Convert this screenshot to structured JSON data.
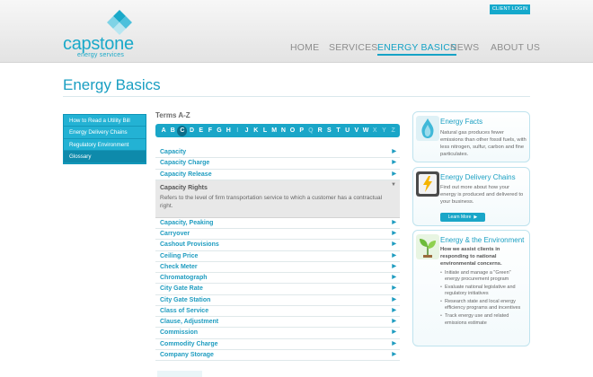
{
  "header": {
    "brand_name": "capstone",
    "brand_sub": "energy services",
    "client_login": "CLIENT LOGIN",
    "nav": [
      {
        "label": "HOME",
        "active": false
      },
      {
        "label": "SERVICES",
        "active": false
      },
      {
        "label": "ENERGY BASICS",
        "active": true
      },
      {
        "label": "NEWS",
        "active": false
      },
      {
        "label": "ABOUT US",
        "active": false
      }
    ]
  },
  "page": {
    "title": "Energy Basics"
  },
  "sidebar": {
    "items": [
      {
        "label": "How to Read a Utility Bill",
        "selected": false
      },
      {
        "label": "Energy Delivery Chains",
        "selected": false
      },
      {
        "label": "Regulatory Environment",
        "selected": false
      },
      {
        "label": "Glossary",
        "selected": true
      }
    ]
  },
  "glossary": {
    "heading": "Terms A-Z",
    "letters": [
      "A",
      "B",
      "C",
      "D",
      "E",
      "F",
      "G",
      "H",
      "I",
      "J",
      "K",
      "L",
      "M",
      "N",
      "O",
      "P",
      "Q",
      "R",
      "S",
      "T",
      "U",
      "V",
      "W",
      "X",
      "Y",
      "Z"
    ],
    "current_letter": "C",
    "disabled_letters": [
      "I",
      "Q",
      "X",
      "Y",
      "Z"
    ],
    "terms_before": [
      "Capacity",
      "Capacity Charge",
      "Capacity Release"
    ],
    "expanded": {
      "title": "Capacity Rights",
      "definition": "Refers to the level of firm transportation service to which a customer has a contractual right."
    },
    "terms_after": [
      "Capacity, Peaking",
      "Carryover",
      "Cashout Provisions",
      "Ceiling Price",
      "Check Meter",
      "Chromatograph",
      "City Gate Rate",
      "City Gate Station",
      "Class of Service",
      "Clause, Adjustment",
      "Commission",
      "Commodity Charge",
      "Company Storage"
    ],
    "arrow_right": "▶",
    "arrow_down": "▼"
  },
  "sidebar_right": {
    "energy_facts": {
      "title": "Energy Facts",
      "text": "Natural gas produces fewer emissions than other fossil fuels, with less nitrogen, sulfur, carbon and fine particulates."
    },
    "delivery_chains": {
      "title": "Energy Delivery Chains",
      "text": "Find out more about how your energy is produced and delivered to your business.",
      "button": "Learn More",
      "button_arrow": "▶"
    },
    "environment": {
      "title": "Energy & the Environment",
      "intro": "How we assist clients in responding to national environmental concerns.",
      "bullets": [
        "Initiate and manage a \"Green\" energy procurement program",
        "Evaluate national legislative and regulatory initiatives",
        "Research state and local energy efficiency programs and incentives",
        "Track energy use and related emissions estimate"
      ]
    }
  },
  "colors": {
    "brand": "#1aa9c9",
    "accent": "#15a9cc",
    "dark_teal": "#0e8aab"
  }
}
